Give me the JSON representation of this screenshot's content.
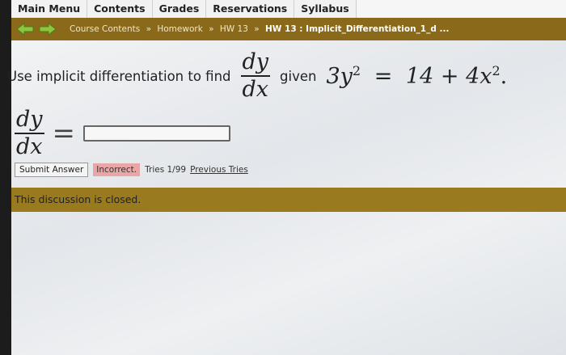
{
  "menu": [
    "Main Menu",
    "Contents",
    "Grades",
    "Reservations",
    "Syllabus"
  ],
  "breadcrumb": {
    "items": [
      "Course Contents",
      "Homework",
      "HW 13"
    ],
    "separator": "»",
    "current": "HW 13 : Implicit_Differentiation_1_d ..."
  },
  "question": {
    "prefix": "Use implicit differentiation to find",
    "frac_num": "dy",
    "frac_den": "dx",
    "given": "given",
    "lhs": "3y",
    "lhs_exp": "2",
    "equals": "=",
    "rhs": "14 + 4x",
    "rhs_exp": "2",
    "period": "."
  },
  "answer": {
    "frac_num": "dy",
    "frac_den": "dx",
    "equals": "=",
    "value": "",
    "placeholder": ""
  },
  "controls": {
    "submit_label": "Submit Answer",
    "status": "Incorrect.",
    "tries": "Tries 1/99",
    "previous_tries": "Previous Tries"
  },
  "discussion": {
    "closed_text": "This discussion is closed."
  },
  "colors": {
    "nav_bar": "#8a6a1a",
    "closed_bar": "#9a7a1e",
    "incorrect_badge": "#e8a6a6",
    "arrow_back": "#8cc63f",
    "arrow_forward": "#8cc63f"
  },
  "icons": {
    "back": "back-arrow-icon",
    "forward": "forward-arrow-icon"
  }
}
